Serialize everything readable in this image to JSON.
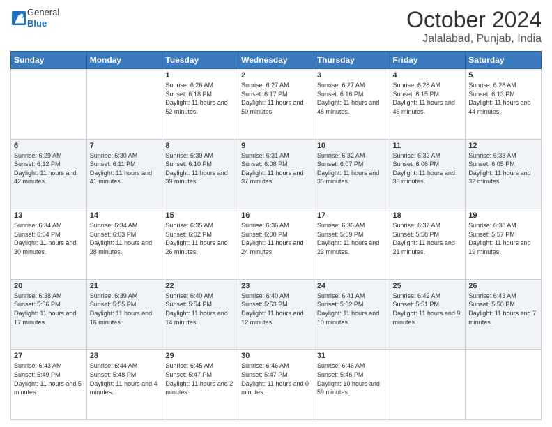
{
  "header": {
    "logo_general": "General",
    "logo_blue": "Blue",
    "title": "October 2024",
    "subtitle": "Jalalabad, Punjab, India"
  },
  "days_of_week": [
    "Sunday",
    "Monday",
    "Tuesday",
    "Wednesday",
    "Thursday",
    "Friday",
    "Saturday"
  ],
  "weeks": [
    [
      {
        "day": "",
        "sunrise": "",
        "sunset": "",
        "daylight": ""
      },
      {
        "day": "",
        "sunrise": "",
        "sunset": "",
        "daylight": ""
      },
      {
        "day": "1",
        "sunrise": "Sunrise: 6:26 AM",
        "sunset": "Sunset: 6:18 PM",
        "daylight": "Daylight: 11 hours and 52 minutes."
      },
      {
        "day": "2",
        "sunrise": "Sunrise: 6:27 AM",
        "sunset": "Sunset: 6:17 PM",
        "daylight": "Daylight: 11 hours and 50 minutes."
      },
      {
        "day": "3",
        "sunrise": "Sunrise: 6:27 AM",
        "sunset": "Sunset: 6:16 PM",
        "daylight": "Daylight: 11 hours and 48 minutes."
      },
      {
        "day": "4",
        "sunrise": "Sunrise: 6:28 AM",
        "sunset": "Sunset: 6:15 PM",
        "daylight": "Daylight: 11 hours and 46 minutes."
      },
      {
        "day": "5",
        "sunrise": "Sunrise: 6:28 AM",
        "sunset": "Sunset: 6:13 PM",
        "daylight": "Daylight: 11 hours and 44 minutes."
      }
    ],
    [
      {
        "day": "6",
        "sunrise": "Sunrise: 6:29 AM",
        "sunset": "Sunset: 6:12 PM",
        "daylight": "Daylight: 11 hours and 42 minutes."
      },
      {
        "day": "7",
        "sunrise": "Sunrise: 6:30 AM",
        "sunset": "Sunset: 6:11 PM",
        "daylight": "Daylight: 11 hours and 41 minutes."
      },
      {
        "day": "8",
        "sunrise": "Sunrise: 6:30 AM",
        "sunset": "Sunset: 6:10 PM",
        "daylight": "Daylight: 11 hours and 39 minutes."
      },
      {
        "day": "9",
        "sunrise": "Sunrise: 6:31 AM",
        "sunset": "Sunset: 6:08 PM",
        "daylight": "Daylight: 11 hours and 37 minutes."
      },
      {
        "day": "10",
        "sunrise": "Sunrise: 6:32 AM",
        "sunset": "Sunset: 6:07 PM",
        "daylight": "Daylight: 11 hours and 35 minutes."
      },
      {
        "day": "11",
        "sunrise": "Sunrise: 6:32 AM",
        "sunset": "Sunset: 6:06 PM",
        "daylight": "Daylight: 11 hours and 33 minutes."
      },
      {
        "day": "12",
        "sunrise": "Sunrise: 6:33 AM",
        "sunset": "Sunset: 6:05 PM",
        "daylight": "Daylight: 11 hours and 32 minutes."
      }
    ],
    [
      {
        "day": "13",
        "sunrise": "Sunrise: 6:34 AM",
        "sunset": "Sunset: 6:04 PM",
        "daylight": "Daylight: 11 hours and 30 minutes."
      },
      {
        "day": "14",
        "sunrise": "Sunrise: 6:34 AM",
        "sunset": "Sunset: 6:03 PM",
        "daylight": "Daylight: 11 hours and 28 minutes."
      },
      {
        "day": "15",
        "sunrise": "Sunrise: 6:35 AM",
        "sunset": "Sunset: 6:02 PM",
        "daylight": "Daylight: 11 hours and 26 minutes."
      },
      {
        "day": "16",
        "sunrise": "Sunrise: 6:36 AM",
        "sunset": "Sunset: 6:00 PM",
        "daylight": "Daylight: 11 hours and 24 minutes."
      },
      {
        "day": "17",
        "sunrise": "Sunrise: 6:36 AM",
        "sunset": "Sunset: 5:59 PM",
        "daylight": "Daylight: 11 hours and 23 minutes."
      },
      {
        "day": "18",
        "sunrise": "Sunrise: 6:37 AM",
        "sunset": "Sunset: 5:58 PM",
        "daylight": "Daylight: 11 hours and 21 minutes."
      },
      {
        "day": "19",
        "sunrise": "Sunrise: 6:38 AM",
        "sunset": "Sunset: 5:57 PM",
        "daylight": "Daylight: 11 hours and 19 minutes."
      }
    ],
    [
      {
        "day": "20",
        "sunrise": "Sunrise: 6:38 AM",
        "sunset": "Sunset: 5:56 PM",
        "daylight": "Daylight: 11 hours and 17 minutes."
      },
      {
        "day": "21",
        "sunrise": "Sunrise: 6:39 AM",
        "sunset": "Sunset: 5:55 PM",
        "daylight": "Daylight: 11 hours and 16 minutes."
      },
      {
        "day": "22",
        "sunrise": "Sunrise: 6:40 AM",
        "sunset": "Sunset: 5:54 PM",
        "daylight": "Daylight: 11 hours and 14 minutes."
      },
      {
        "day": "23",
        "sunrise": "Sunrise: 6:40 AM",
        "sunset": "Sunset: 5:53 PM",
        "daylight": "Daylight: 11 hours and 12 minutes."
      },
      {
        "day": "24",
        "sunrise": "Sunrise: 6:41 AM",
        "sunset": "Sunset: 5:52 PM",
        "daylight": "Daylight: 11 hours and 10 minutes."
      },
      {
        "day": "25",
        "sunrise": "Sunrise: 6:42 AM",
        "sunset": "Sunset: 5:51 PM",
        "daylight": "Daylight: 11 hours and 9 minutes."
      },
      {
        "day": "26",
        "sunrise": "Sunrise: 6:43 AM",
        "sunset": "Sunset: 5:50 PM",
        "daylight": "Daylight: 11 hours and 7 minutes."
      }
    ],
    [
      {
        "day": "27",
        "sunrise": "Sunrise: 6:43 AM",
        "sunset": "Sunset: 5:49 PM",
        "daylight": "Daylight: 11 hours and 5 minutes."
      },
      {
        "day": "28",
        "sunrise": "Sunrise: 6:44 AM",
        "sunset": "Sunset: 5:48 PM",
        "daylight": "Daylight: 11 hours and 4 minutes."
      },
      {
        "day": "29",
        "sunrise": "Sunrise: 6:45 AM",
        "sunset": "Sunset: 5:47 PM",
        "daylight": "Daylight: 11 hours and 2 minutes."
      },
      {
        "day": "30",
        "sunrise": "Sunrise: 6:46 AM",
        "sunset": "Sunset: 5:47 PM",
        "daylight": "Daylight: 11 hours and 0 minutes."
      },
      {
        "day": "31",
        "sunrise": "Sunrise: 6:46 AM",
        "sunset": "Sunset: 5:46 PM",
        "daylight": "Daylight: 10 hours and 59 minutes."
      },
      {
        "day": "",
        "sunrise": "",
        "sunset": "",
        "daylight": ""
      },
      {
        "day": "",
        "sunrise": "",
        "sunset": "",
        "daylight": ""
      }
    ]
  ]
}
